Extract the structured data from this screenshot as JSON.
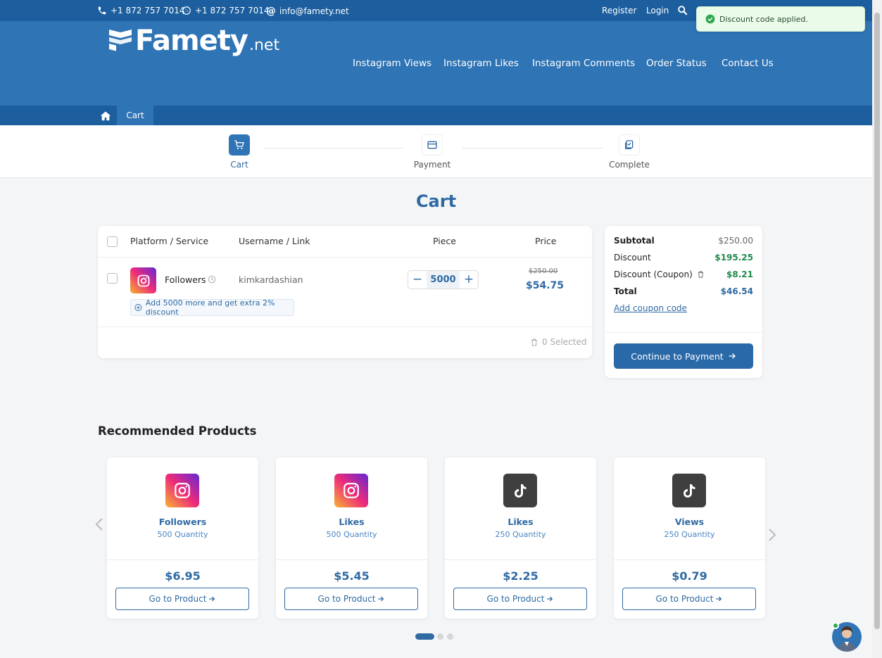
{
  "topbar": {
    "phone": "+1 872 757 7014",
    "whatsapp": "+1 872 757 7014",
    "email": "info@famety.net",
    "register": "Register",
    "login": "Login"
  },
  "logo": {
    "main": "Famety",
    "suffix": ".net"
  },
  "nav": [
    "Instagram Views",
    "Instagram Likes",
    "Instagram Comments",
    "Order Status",
    "Contact Us"
  ],
  "breadcrumb": {
    "current": "Cart"
  },
  "steps": [
    "Cart",
    "Payment",
    "Complete"
  ],
  "page_title": "Cart",
  "table": {
    "headers": [
      "Platform / Service",
      "Username / Link",
      "Piece",
      "Price"
    ],
    "row": {
      "service": "Followers",
      "username": "kimkardashian",
      "quantity": "5000",
      "old_price": "$250.00",
      "price": "$54.75",
      "upsell": "Add 5000 more and get extra 2% discount"
    },
    "selected": "0 Selected"
  },
  "summary": {
    "subtotal_label": "Subtotal",
    "subtotal": "$250.00",
    "discount_label": "Discount",
    "discount": "$195.25",
    "coupon_label": "Discount (Coupon)",
    "coupon": "$8.21",
    "total_label": "Total",
    "total": "$46.54",
    "add_coupon": "Add coupon code",
    "continue": "Continue to Payment"
  },
  "recommended": {
    "title": "Recommended Products",
    "items": [
      {
        "platform": "instagram",
        "name": "Followers",
        "qty": "500 Quantity",
        "price": "$6.95",
        "button": "Go to Product"
      },
      {
        "platform": "instagram",
        "name": "Likes",
        "qty": "500 Quantity",
        "price": "$5.45",
        "button": "Go to Product"
      },
      {
        "platform": "tiktok",
        "name": "Likes",
        "qty": "250 Quantity",
        "price": "$2.25",
        "button": "Go to Product"
      },
      {
        "platform": "tiktok",
        "name": "Views",
        "qty": "250 Quantity",
        "price": "$0.79",
        "button": "Go to Product"
      }
    ]
  },
  "toast": {
    "message": "Discount code applied."
  },
  "colors": {
    "primary": "#2f74b5",
    "dark": "#1c5e9e",
    "accent_green": "#1e8a4a"
  }
}
